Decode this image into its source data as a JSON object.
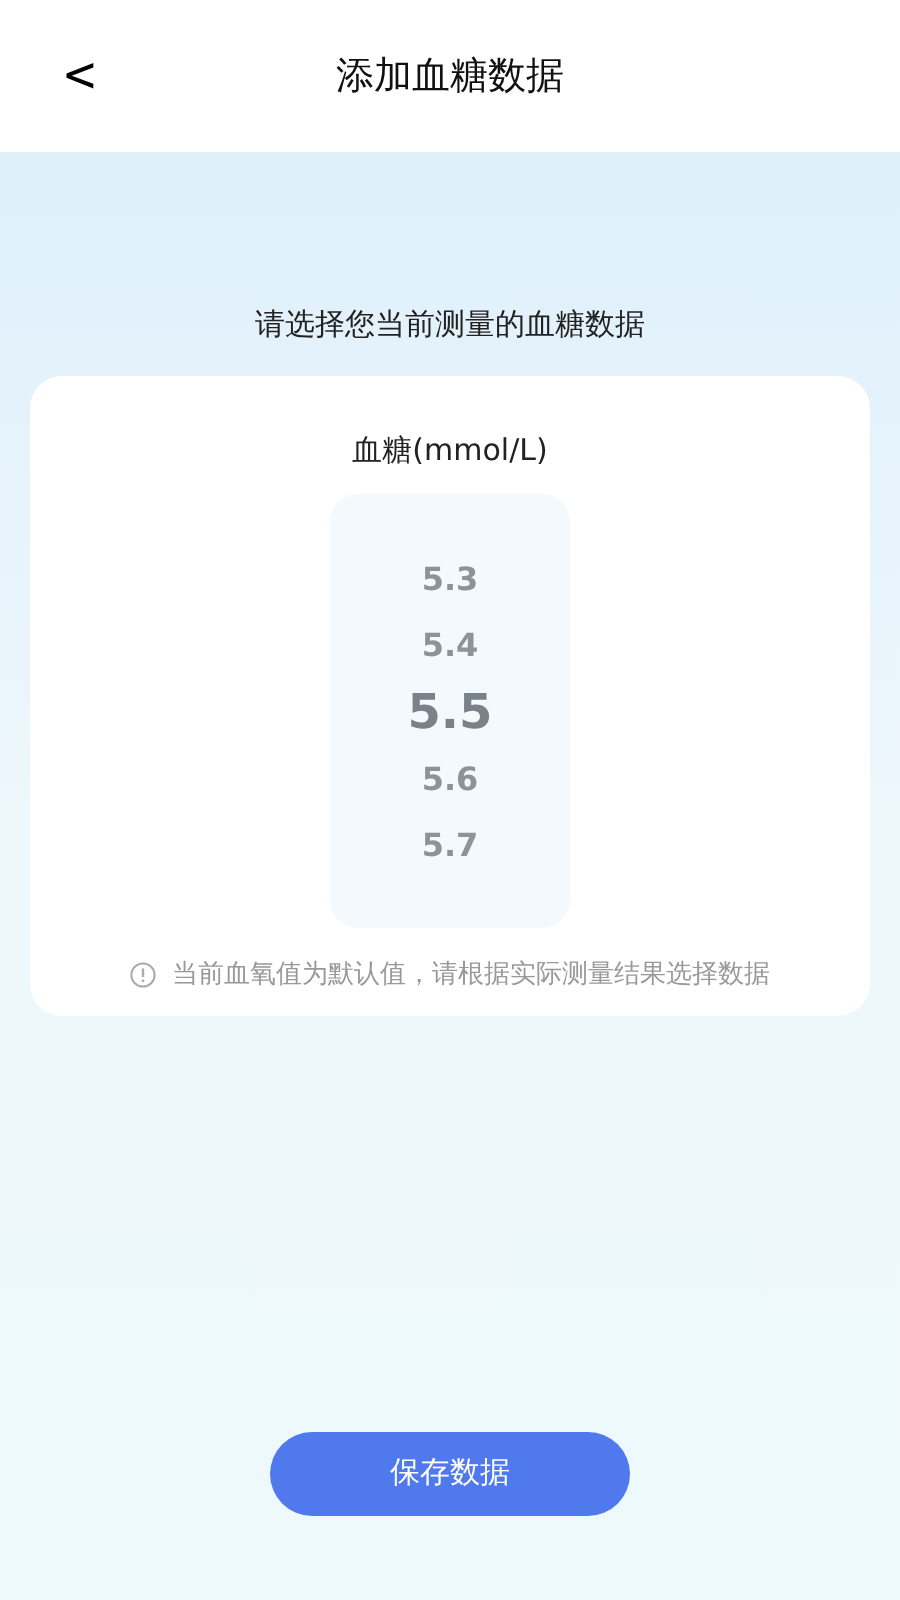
{
  "header": {
    "back": "<",
    "title": "添加血糖数据"
  },
  "prompt": "请选择您当前测量的血糖数据",
  "card": {
    "label": "血糖(mmol/L)",
    "picker": [
      {
        "value": "5.3",
        "selected": false
      },
      {
        "value": "5.4",
        "selected": false
      },
      {
        "value": "5.5",
        "selected": true
      },
      {
        "value": "5.6",
        "selected": false
      },
      {
        "value": "5.7",
        "selected": false
      }
    ],
    "note": "当前血氧值为默认值，请根据实际测量结果选择数据"
  },
  "button": "保存数据"
}
